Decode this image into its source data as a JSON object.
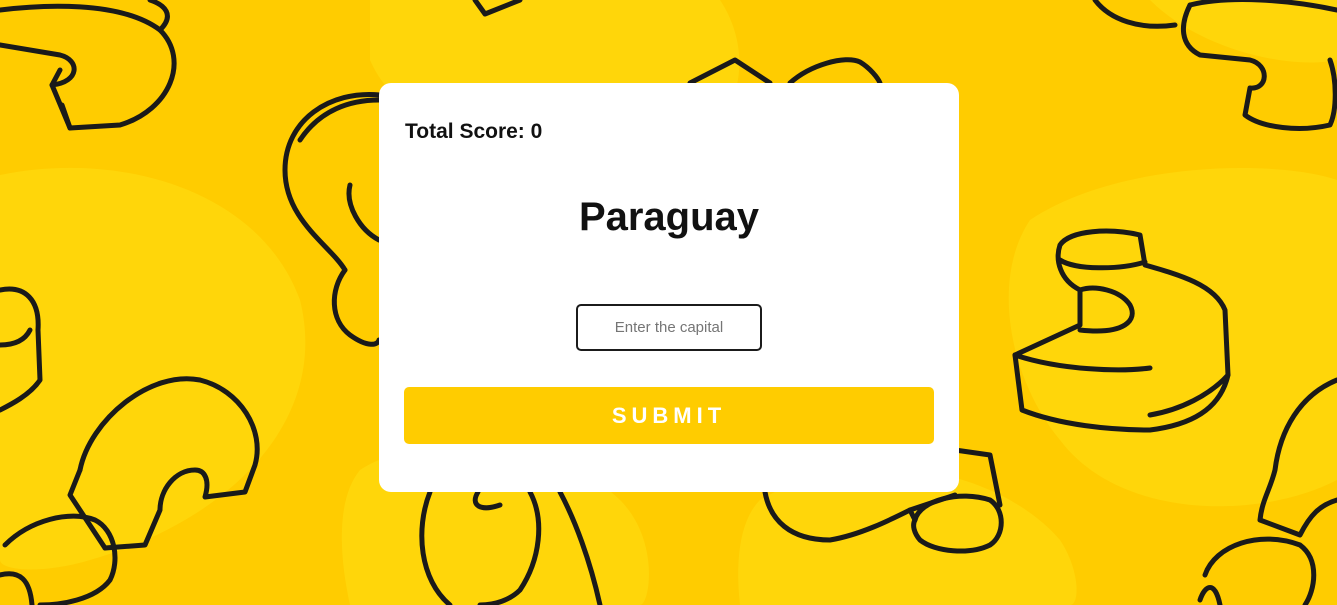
{
  "quiz": {
    "score_text": "Total Score: 0",
    "country": "Paraguay",
    "input_value": "",
    "input_placeholder": "Enter the capital",
    "submit_label": "SUBMIT"
  },
  "colors": {
    "background": "#ffcc00",
    "background_blob": "#ffd60a",
    "card": "#ffffff",
    "accent": "#ffcc00",
    "button_text": "#ffffff",
    "text": "#111111",
    "doodle_outline": "#1a1a1a"
  },
  "icons": {
    "background_decoration": "question-mark-doodle-pattern"
  }
}
